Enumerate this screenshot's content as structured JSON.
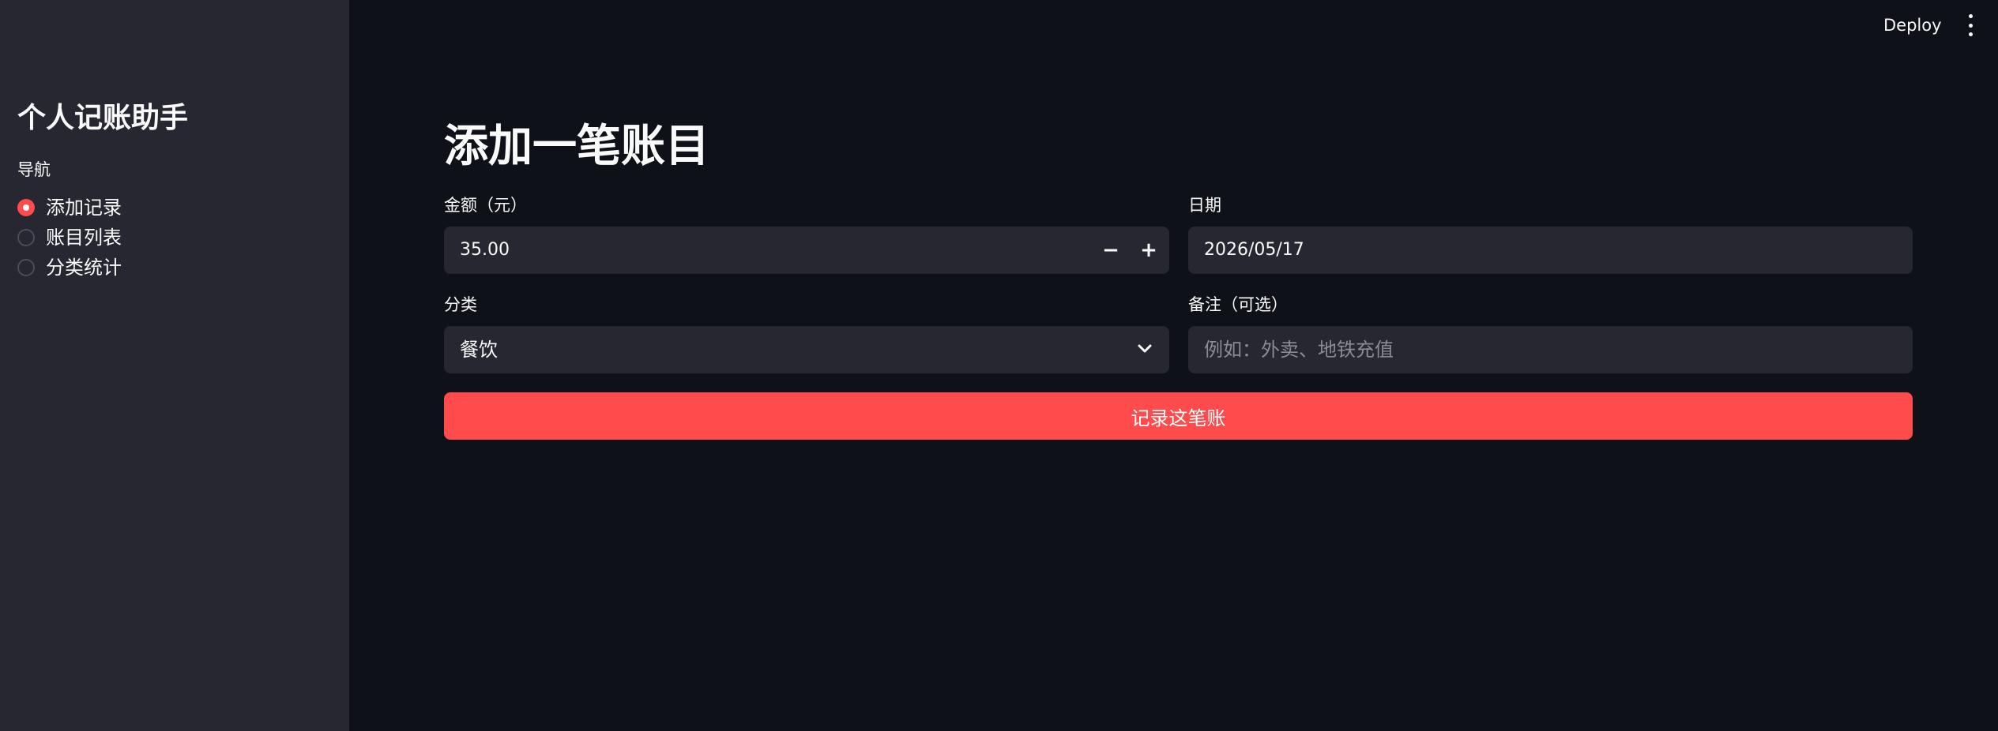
{
  "header": {
    "deploy_label": "Deploy",
    "menu_icon": "vertical-ellipsis-icon"
  },
  "sidebar": {
    "title": "个人记账助手",
    "nav_label": "导航",
    "nav_items": [
      {
        "label": "添加记录",
        "selected": true
      },
      {
        "label": "账目列表",
        "selected": false
      },
      {
        "label": "分类统计",
        "selected": false
      }
    ]
  },
  "main": {
    "title": "添加一笔账目",
    "amount": {
      "label": "金额（元）",
      "value": "35.00",
      "minus": "−",
      "plus": "+"
    },
    "date": {
      "label": "日期",
      "value": "2026/05/17"
    },
    "category": {
      "label": "分类",
      "value": "餐饮",
      "icon": "chevron-down-icon"
    },
    "note": {
      "label": "备注（可选）",
      "placeholder": "例如：外卖、地铁充值",
      "value": ""
    },
    "submit_label": "记录这笔账"
  },
  "colors": {
    "background": "#0e1117",
    "sidebar": "#262730",
    "input": "#262730",
    "accent": "#ff4b4b",
    "text": "#fafafa"
  }
}
